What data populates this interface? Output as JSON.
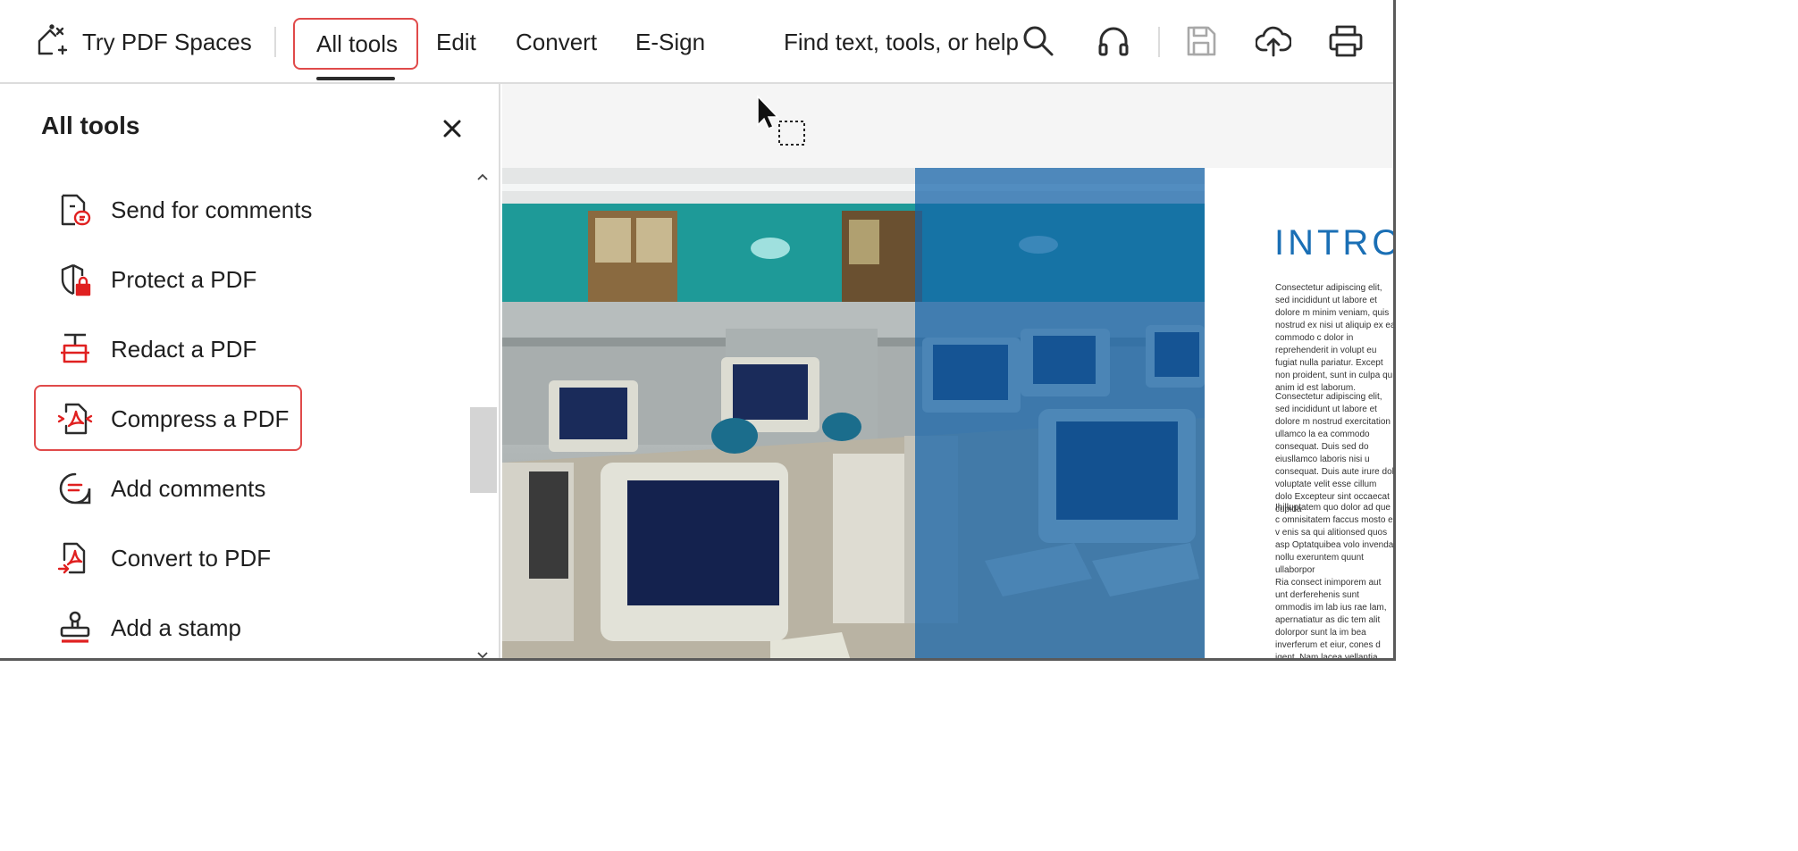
{
  "toolbar": {
    "try_spaces_label": "Try PDF Spaces",
    "tabs": [
      "All tools",
      "Edit",
      "Convert",
      "E-Sign"
    ],
    "search_label": "Find text, tools, or help"
  },
  "panel": {
    "title": "All tools",
    "tools": [
      {
        "label": "Send for comments",
        "icon": "send-for-comments-icon"
      },
      {
        "label": "Protect a PDF",
        "icon": "protect-icon"
      },
      {
        "label": "Redact a PDF",
        "icon": "redact-icon"
      },
      {
        "label": "Compress a PDF",
        "icon": "compress-icon"
      },
      {
        "label": "Add comments",
        "icon": "comment-icon"
      },
      {
        "label": "Convert to PDF",
        "icon": "convert-icon"
      },
      {
        "label": "Add a stamp",
        "icon": "stamp-icon"
      }
    ]
  },
  "document": {
    "heading": "INTRO",
    "paragraphs": [
      "Consectetur adipiscing elit, sed incididunt ut labore et dolore m minim veniam, quis nostrud ex nisi ut aliquip ex ea commodo c dolor in reprehenderit in volupt eu fugiat nulla pariatur. Except non proident, sunt in culpa qui anim id est laborum.",
      "Consectetur adipiscing elit, sed incididunt ut labore et dolore m nostrud exercitation ullamco la ea commodo consequat. Duis sed do eiusllamco laboris nisi u consequat. Duis aute irure dol voluptate velit esse cillum dolo Excepteur sint occaecat cupida",
      "Ihilluptatem quo dolor ad que c omnisitatem faccus mosto et v enis sa qui alitionsed quos asp Optatquibea volo invenda nollu exeruntem quunt ullaborpor",
      "Ria consect inimporem aut unt derferehenis sunt ommodis im lab ius rae lam, apernatiatur as dic tem alit dolorpor sunt la im bea inverferum et eiur, cones d igent. Nam lacea vellantia sinct"
    ]
  },
  "colors": {
    "accent_red": "#e04a4a",
    "icon_red": "#e02020",
    "heading_blue": "#1a6fb5",
    "overlay_blue": "#1464aa"
  }
}
